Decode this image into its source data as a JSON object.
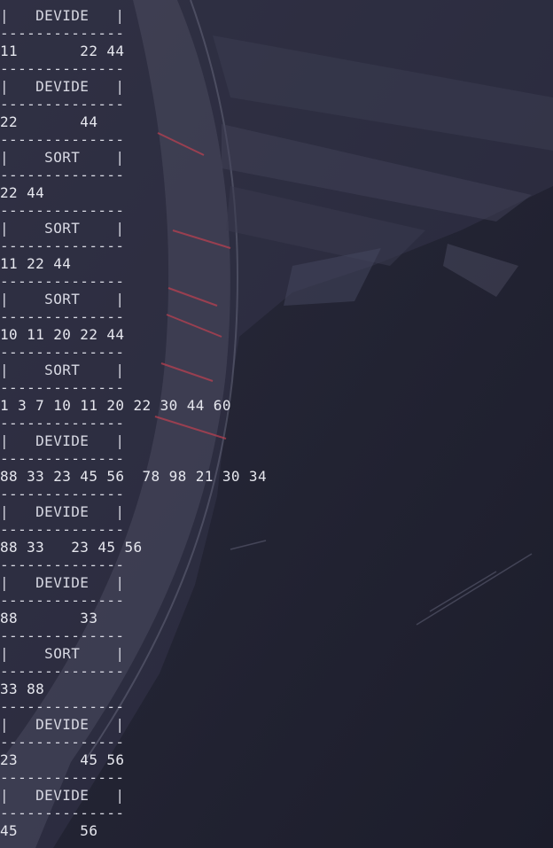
{
  "terminal": {
    "blocks": [
      {
        "title": "|   DEVIDE   |",
        "numbers": "11       22 44"
      },
      {
        "title": "|   DEVIDE   |",
        "numbers": "22       44"
      },
      {
        "title": "|    SORT    |",
        "numbers": "22 44"
      },
      {
        "title": "|    SORT    |",
        "numbers": "11 22 44"
      },
      {
        "title": "|    SORT    |",
        "numbers": "10 11 20 22 44"
      },
      {
        "title": "|    SORT    |",
        "numbers": "1 3 7 10 11 20 22 30 44 60"
      },
      {
        "title": "|   DEVIDE   |",
        "numbers": "88 33 23 45 56  78 98 21 30 34"
      },
      {
        "title": "|   DEVIDE   |",
        "numbers": "88 33   23 45 56"
      },
      {
        "title": "|   DEVIDE   |",
        "numbers": "88       33"
      },
      {
        "title": "|    SORT    |",
        "numbers": "33 88"
      },
      {
        "title": "|   DEVIDE   |",
        "numbers": "23       45 56"
      },
      {
        "title": "|   DEVIDE   |",
        "numbers": "45       56"
      }
    ],
    "separator": "--------------"
  }
}
